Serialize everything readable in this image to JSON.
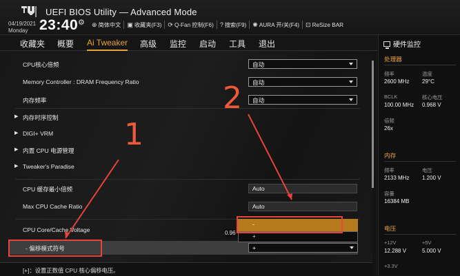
{
  "header": {
    "title": "UEFI BIOS Utility — Advanced Mode",
    "date": "04/19/2021",
    "day": "Monday",
    "time": "23:40",
    "tools": [
      {
        "icon": "globe-icon",
        "glyph": "⊕",
        "label": "简体中文"
      },
      {
        "icon": "favorites-icon",
        "glyph": "▣",
        "label": "收藏夹(F3)"
      },
      {
        "icon": "fan-icon",
        "glyph": "⟳",
        "label": "Q-Fan 控制(F6)"
      },
      {
        "icon": "search-icon",
        "glyph": "?",
        "label": "搜索(F9)"
      },
      {
        "icon": "aura-icon",
        "glyph": "✺",
        "label": "AURA 开/关(F4)"
      },
      {
        "icon": "resize-bar-icon",
        "glyph": "⊡",
        "label": "ReSize BAR"
      }
    ]
  },
  "menu": [
    "收藏夹",
    "概要",
    "Ai Tweaker",
    "高级",
    "监控",
    "启动",
    "工具",
    "退出"
  ],
  "active_menu": "Ai Tweaker",
  "settings": [
    {
      "label": "CPU核心倍频",
      "value": "自动",
      "kind": "select"
    },
    {
      "label": "Memory Controller : DRAM Frequency Ratio",
      "value": "自动",
      "kind": "select"
    },
    {
      "label": "内存频率",
      "value": "自动",
      "kind": "select"
    },
    {
      "label": "内存时序控制",
      "kind": "submenu"
    },
    {
      "label": "DIGI+ VRM",
      "kind": "submenu"
    },
    {
      "label": "内置 CPU 电源管理",
      "kind": "submenu"
    },
    {
      "label": "Tweaker's Paradise",
      "kind": "submenu"
    },
    {
      "label": "CPU 缓存最小倍频",
      "value": "Auto",
      "kind": "input"
    },
    {
      "label": "Max CPU Cache Ratio",
      "value": "Auto",
      "kind": "input"
    },
    {
      "label": "CPU Core/Cache Voltage",
      "value": "0.96",
      "kind": "voltage"
    },
    {
      "label": "- 偏移模式符号",
      "value": "+",
      "kind": "select"
    }
  ],
  "dropdown_options": [
    "-",
    "+"
  ],
  "description": "[+]：设置正数值 CPU 核心偏移电压。",
  "annotations": [
    "1",
    "2"
  ],
  "hw_monitor": {
    "title": "硬件监控",
    "sections": [
      {
        "name": "处理器",
        "rows": [
          [
            {
              "label": "频率",
              "value": "2600 MHz"
            },
            {
              "label": "温度",
              "value": "29°C"
            }
          ],
          [
            {
              "label": "BCLK",
              "value": "100.00 MHz"
            },
            {
              "label": "核心电压",
              "value": "0.968 V"
            }
          ],
          [
            {
              "label": "倍频",
              "value": "26x"
            }
          ]
        ]
      },
      {
        "name": "内存",
        "rows": [
          [
            {
              "label": "频率",
              "value": "2133 MHz"
            },
            {
              "label": "电压",
              "value": "1.200 V"
            }
          ],
          [
            {
              "label": "容量",
              "value": "16384 MB"
            }
          ]
        ]
      },
      {
        "name": "电压",
        "rows": [
          [
            {
              "label": "+12V",
              "value": "12.288 V"
            },
            {
              "label": "+5V",
              "value": "5.000 V"
            }
          ],
          [
            {
              "label": "+3.3V",
              "value": ""
            }
          ]
        ]
      }
    ]
  },
  "colors": {
    "accent": "#e8a33c",
    "annotation": "#e8433c",
    "dropdown_highlight": "#b77a1c"
  }
}
